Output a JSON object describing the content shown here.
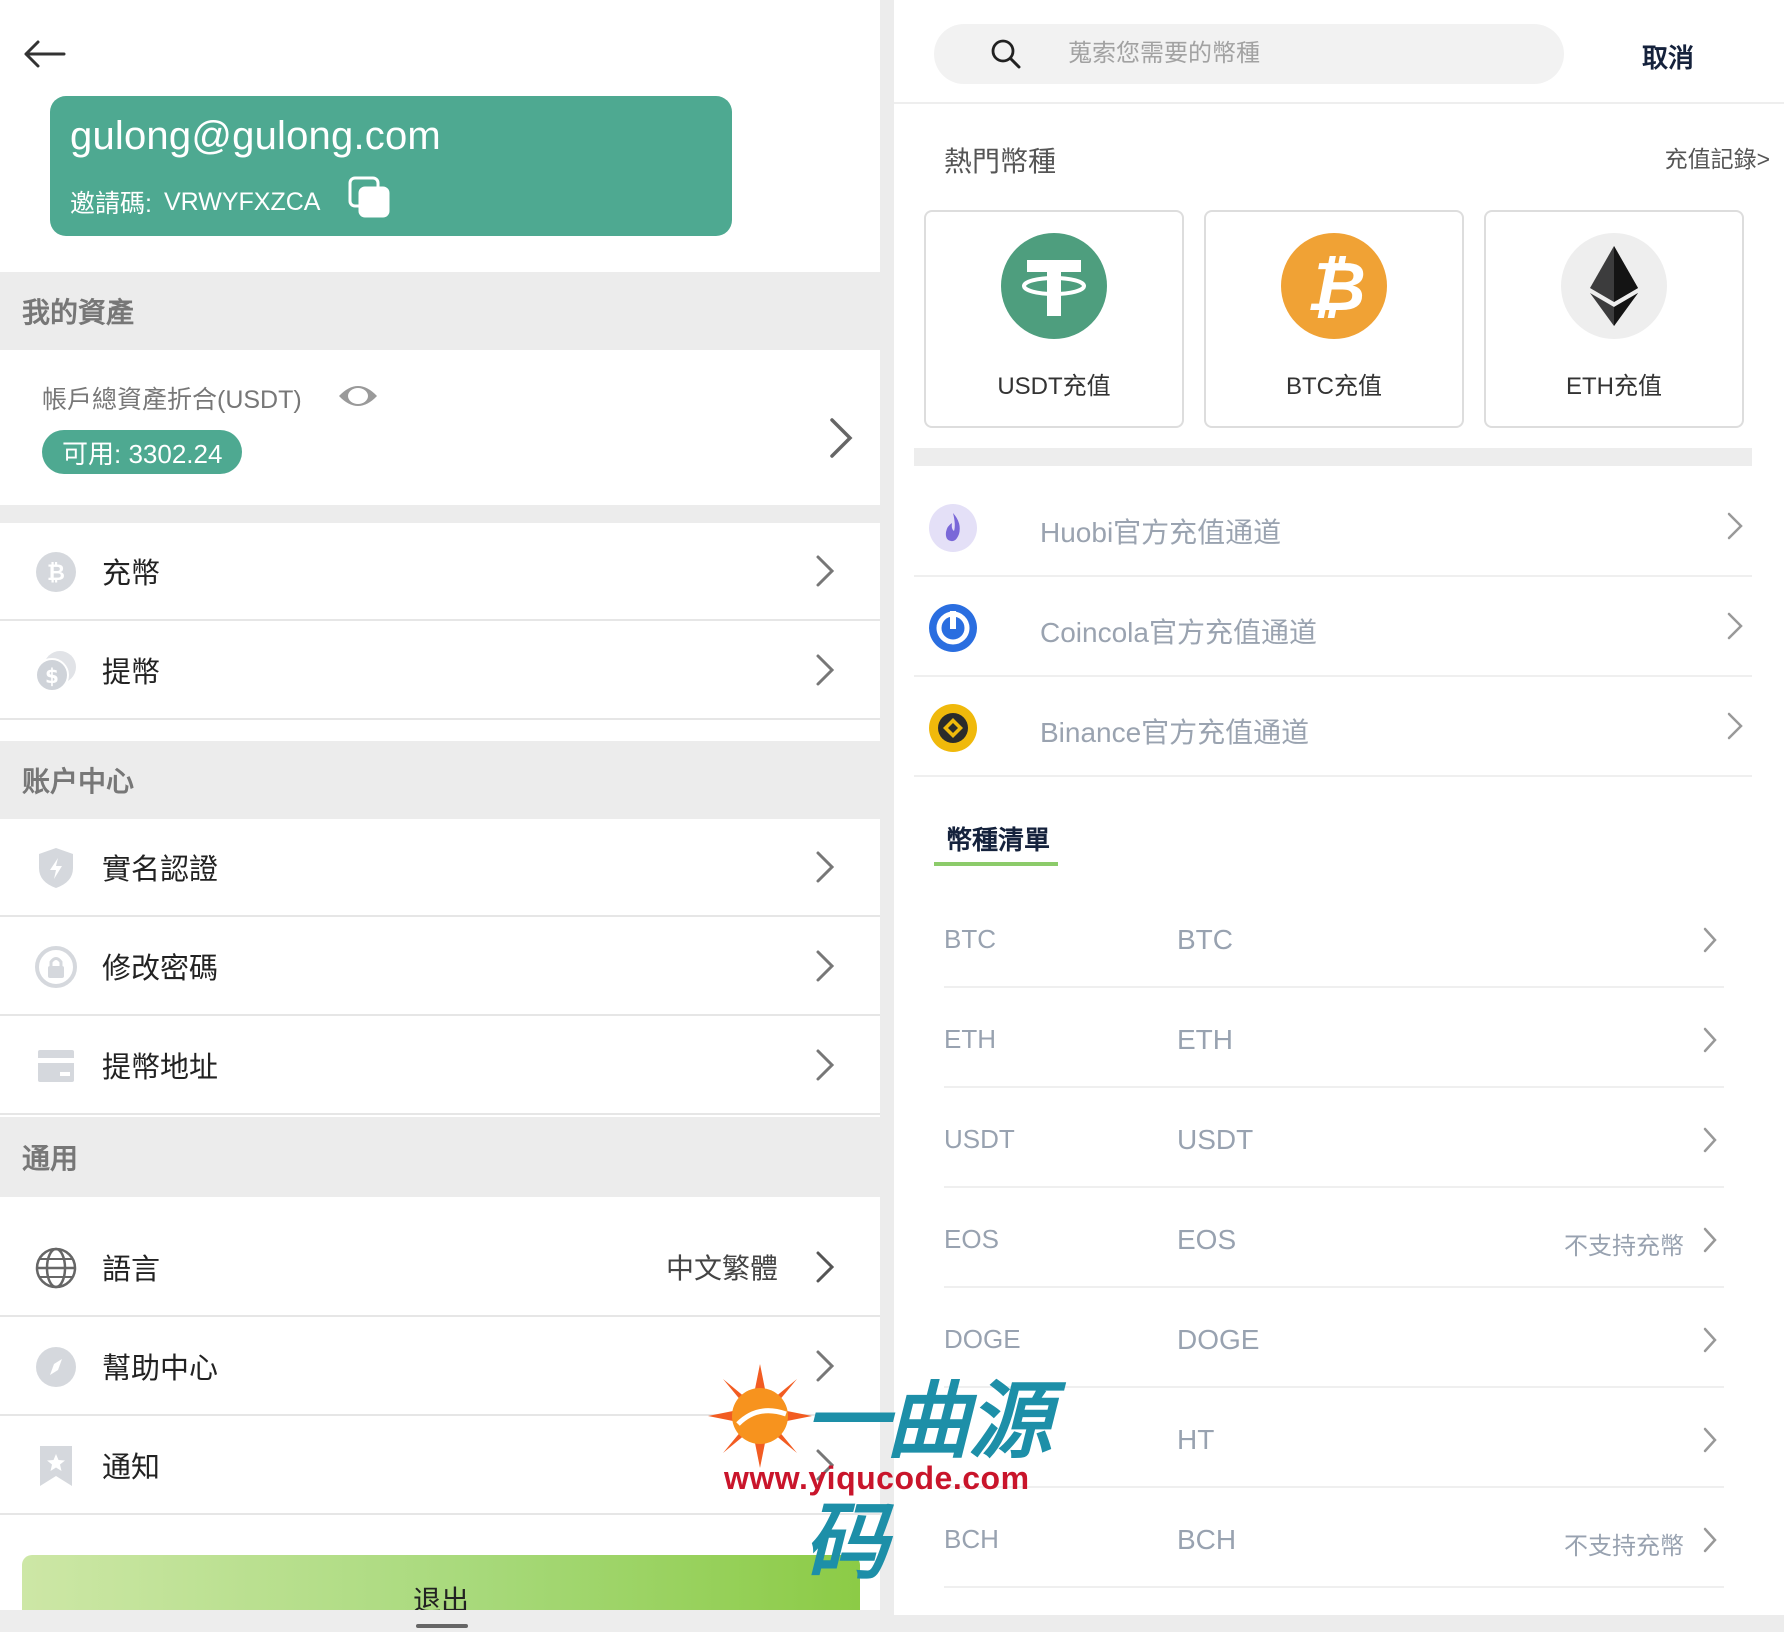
{
  "left": {
    "profile": {
      "email": "gulong@gulong.com",
      "invite_label": "邀請碼:",
      "invite_code": "VRWYFXZCA"
    },
    "sections": {
      "assets": "我的資產",
      "account": "账户中心",
      "general": "通用"
    },
    "assets": {
      "title": "帳戶總資產折合(USDT)",
      "available": "可用: 3302.24"
    },
    "menu": {
      "deposit": "充幣",
      "withdraw": "提幣",
      "verify": "實名認證",
      "password": "修改密碼",
      "address": "提幣地址",
      "language": "語言",
      "language_value": "中文繁體",
      "help": "幫助中心",
      "notice": "通知"
    },
    "logout": "退出",
    "icons": {
      "back": "arrow-left-icon",
      "copy": "copy-icon",
      "eye": "eye-icon",
      "deposit": "bitcoin-coin-icon",
      "withdraw": "dollar-coin-icon",
      "verify": "shield-icon",
      "password": "lock-icon",
      "address": "card-icon",
      "language": "globe-icon",
      "help": "compass-icon",
      "notice": "bookmark-star-icon"
    }
  },
  "right": {
    "search": {
      "placeholder": "蒐索您需要的幣種"
    },
    "cancel": "取消",
    "hot_title": "熱門幣種",
    "record_link": "充值記錄>",
    "hot_coins": [
      {
        "name": "USDT充值",
        "color": "#4e9e7e"
      },
      {
        "name": "BTC充值",
        "color": "#f0a235"
      },
      {
        "name": "ETH充值",
        "color": "#eeeeee"
      }
    ],
    "channels": [
      {
        "label": "Huobi官方充值通道"
      },
      {
        "label": "Coincola官方充值通道"
      },
      {
        "label": "Binance官方充值通道"
      }
    ],
    "list_tab": "幣種清單",
    "coin_list": [
      {
        "symbol": "BTC",
        "name": "BTC",
        "note": ""
      },
      {
        "symbol": "ETH",
        "name": "ETH",
        "note": ""
      },
      {
        "symbol": "USDT",
        "name": "USDT",
        "note": ""
      },
      {
        "symbol": "EOS",
        "name": "EOS",
        "note": "不支持充幣"
      },
      {
        "symbol": "DOGE",
        "name": "DOGE",
        "note": ""
      },
      {
        "symbol": "",
        "name": "HT",
        "note": ""
      },
      {
        "symbol": "BCH",
        "name": "BCH",
        "note": "不支持充幣"
      }
    ]
  },
  "watermark": {
    "title": "一曲源码",
    "url": "www.yiqucode.com"
  },
  "colors": {
    "brand_green": "#4ea991",
    "logout_gradient_end": "#8ccb46",
    "tab_underline": "#8ccb6a",
    "watermark_blue": "#1d8fa8",
    "watermark_red": "#c9152b"
  }
}
